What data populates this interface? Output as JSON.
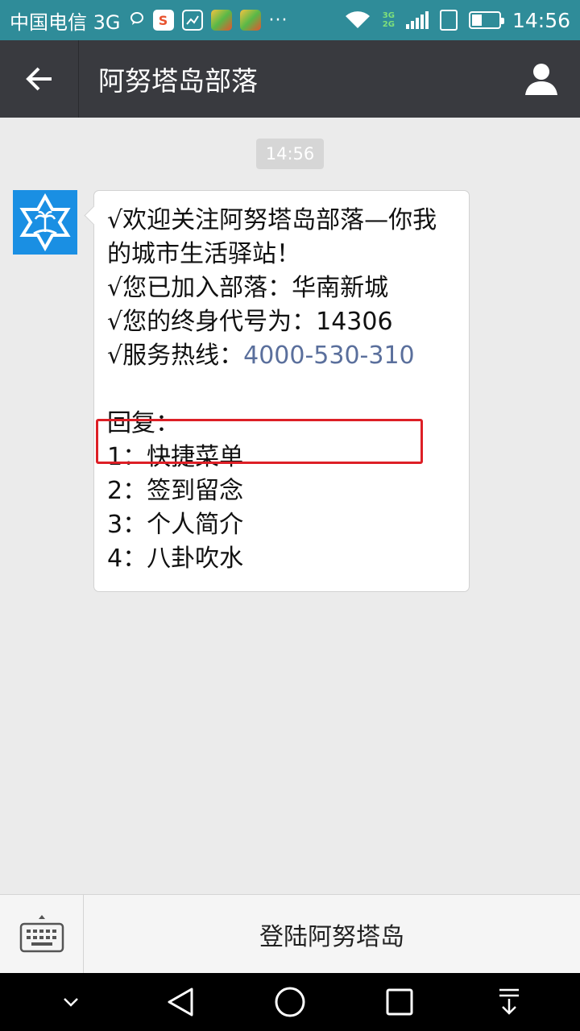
{
  "status_bar": {
    "carrier": "中国电信 3G",
    "network_badge": "3G\n2G",
    "time": "14:56",
    "icons": [
      "chat-bubble-icon",
      "sogou-icon",
      "image-icon",
      "app-icon",
      "app-icon",
      "more-icon",
      "wifi-icon",
      "signal-icon",
      "sim-icon",
      "battery-icon"
    ]
  },
  "nav": {
    "title": "阿努塔岛部落",
    "back_icon": "arrow-left-icon",
    "profile_icon": "person-icon"
  },
  "chat": {
    "timestamp": "14:56",
    "message": {
      "lines": [
        "√欢迎关注阿努塔岛部落—你我",
        "的城市生活驿站！",
        "√您已加入部落：华南新城",
        "√您的终身代号为：14306",
        "√服务热线："
      ],
      "phone": "4000-530-310",
      "reply_header": "回复：",
      "options": [
        "1：快捷菜单",
        "2：签到留念",
        "3：个人简介",
        "4：八卦吹水"
      ]
    },
    "highlight_color": "#dd1f26"
  },
  "bottom_bar": {
    "menu_label": "登陆阿努塔岛",
    "keyboard_icon": "keyboard-icon"
  },
  "system_nav": {
    "icons": [
      "chevron-down-icon",
      "back-triangle-icon",
      "home-circle-icon",
      "recents-square-icon",
      "notification-pull-icon"
    ]
  },
  "colors": {
    "status_bar": "#2f8c99",
    "nav_bar": "#393a3f",
    "chat_bg": "#ebebeb",
    "avatar_bg": "#1a8fe3",
    "link": "#5a6f9c"
  }
}
